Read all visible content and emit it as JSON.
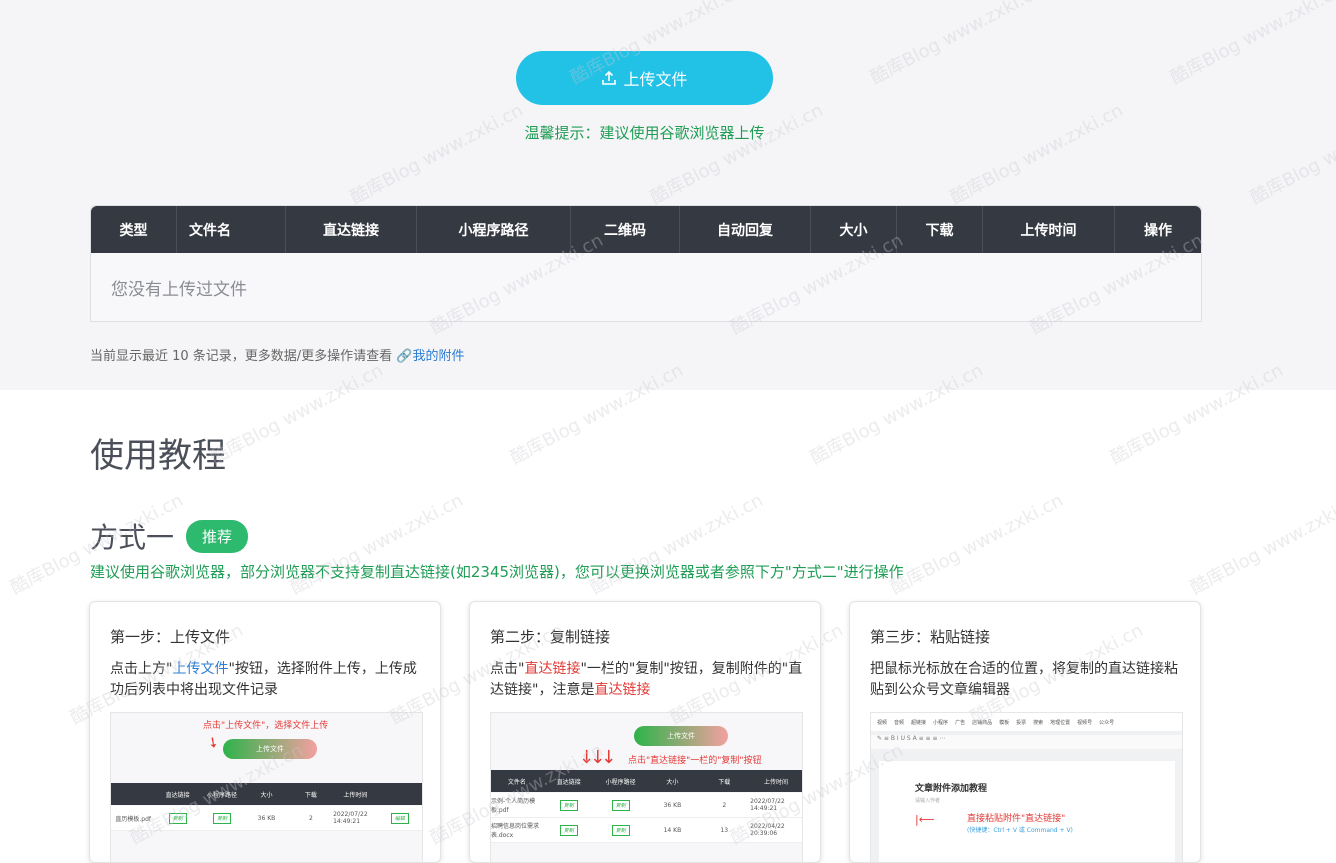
{
  "upload": {
    "label": "上传文件",
    "hint": "温馨提示：建议使用谷歌浏览器上传"
  },
  "table": {
    "headers": [
      "类型",
      "文件名",
      "直达链接",
      "小程序路径",
      "二维码",
      "自动回复",
      "大小",
      "下载",
      "上传时间",
      "操作"
    ],
    "empty_text": "您没有上传过文件"
  },
  "note": {
    "text": "当前显示最近 10 条记录，更多数据/更多操作请查看 ",
    "link": "我的附件"
  },
  "tutorial": {
    "title": "使用教程",
    "method_title": "方式一",
    "badge": "推荐",
    "subtitle": "建议使用谷歌浏览器，部分浏览器不支持复制直达链接(如2345浏览器)，您可以更换浏览器或者参照下方\"方式二\"进行操作"
  },
  "cards": [
    {
      "title": "第一步：上传文件",
      "desc_a": "点击上方\"",
      "desc_hl": "上传文件",
      "desc_b": "\"按钮，选择附件上传，上传成功后列表中将出现文件记录",
      "shot_hint": "点击\"上传文件\"，选择文件上传",
      "shot_btn": "上传文件",
      "shot_headers": [
        "直达链接",
        "小程序路径",
        "大小",
        "下载",
        "上传时间"
      ],
      "shot_row": [
        "直历模板.pdf",
        "复制",
        "复制",
        "36 KB",
        "2",
        "2022/07/22 14:49:21",
        "编辑"
      ]
    },
    {
      "title": "第二步：复制链接",
      "desc_a": "点击\"",
      "desc_hl": "直达链接",
      "desc_b": "\"一栏的\"复制\"按钮，复制附件的\"直达链接\"，注意是",
      "desc_hl2": "直达链接",
      "shot_hint": "点击\"直达链接\"一栏的\"复制\"按钮",
      "shot_btn": "上传文件",
      "shot_headers": [
        "文件名",
        "直达链接",
        "小程序路径",
        "大小",
        "下载",
        "上传时间"
      ],
      "shot_row": [
        "示例-个人简历模板.pdf",
        "复制",
        "复制",
        "36 KB",
        "2",
        "2022/07/22 14:49:21"
      ],
      "shot_row2": [
        "招聘信息岗位需求表.docx",
        "复制",
        "复制",
        "14 KB",
        "13",
        "2022/04/22 20:39:06"
      ]
    },
    {
      "title": "第三步：粘贴链接",
      "desc": "把鼠标光标放在合适的位置，将复制的直达链接粘贴到公众号文章编辑器",
      "shot_tabs": [
        "视频",
        "音频",
        "超链接",
        "小程序",
        "广告",
        "店铺商品",
        "模板",
        "投票",
        "搜索",
        "地理位置",
        "视频号",
        "公众号"
      ],
      "shot_doc_title": "文章附件添加教程",
      "shot_doc_author": "请输入作者",
      "shot_paste": "直接粘贴附件\"直达链接\"",
      "shot_shortcut": "(快捷键：Ctrl + V 或 Command + V)"
    }
  ],
  "watermark": "酷库Blog www.zxki.cn"
}
